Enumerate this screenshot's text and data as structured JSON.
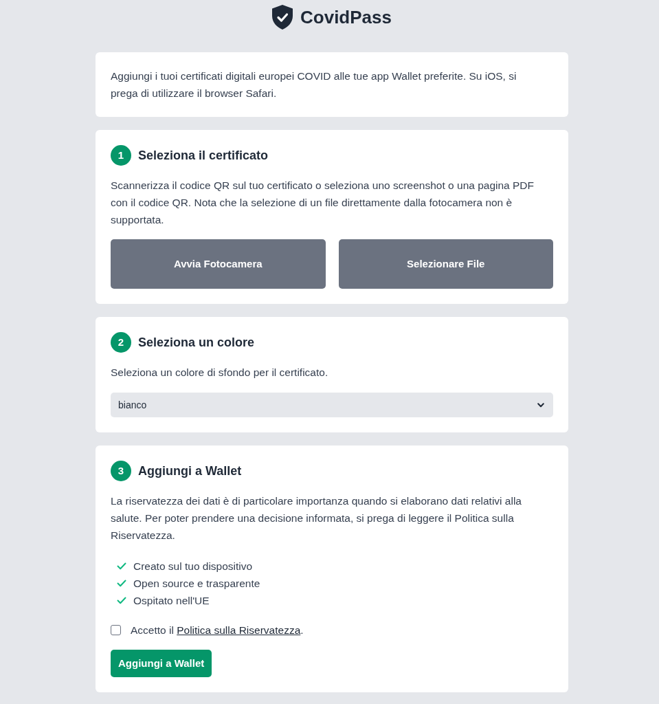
{
  "header": {
    "title": "CovidPass"
  },
  "intro": {
    "text": "Aggiungi i tuoi certificati digitali europei COVID alle tue app Wallet preferite. Su iOS, si prega di utilizzare il browser Safari."
  },
  "steps": [
    {
      "kind": "buttons",
      "number": "1",
      "title": "Seleziona il certificato",
      "description": "Scannerizza il codice QR sul tuo certificato o seleziona uno screenshot o una pagina PDF con il codice QR. Nota che la selezione di un file direttamente dalla fotocamera non è supportata.",
      "buttons": [
        "Avvia Fotocamera",
        "Selezionare File"
      ]
    },
    {
      "kind": "select",
      "number": "2",
      "title": "Seleziona un colore",
      "description": "Seleziona un colore di sfondo per il certificato.",
      "select": {
        "value": "bianco"
      }
    },
    {
      "kind": "wallet",
      "number": "3",
      "title": "Aggiungi a Wallet",
      "description": "La riservatezza dei dati è di particolare importanza quando si elaborano dati relativi alla salute. Per poter prendere una decisione informata, si prega di leggere il Politica sulla Riservatezza.",
      "features": [
        "Creato sul tuo dispositivo",
        "Open source e trasparente",
        "Ospitato nell'UE"
      ],
      "consent": {
        "checked": false,
        "prefix": "Accetto il",
        "link": "Politica sulla Riservatezza",
        "suffix": "."
      },
      "submit": "Aggiungi a Wallet"
    }
  ]
}
